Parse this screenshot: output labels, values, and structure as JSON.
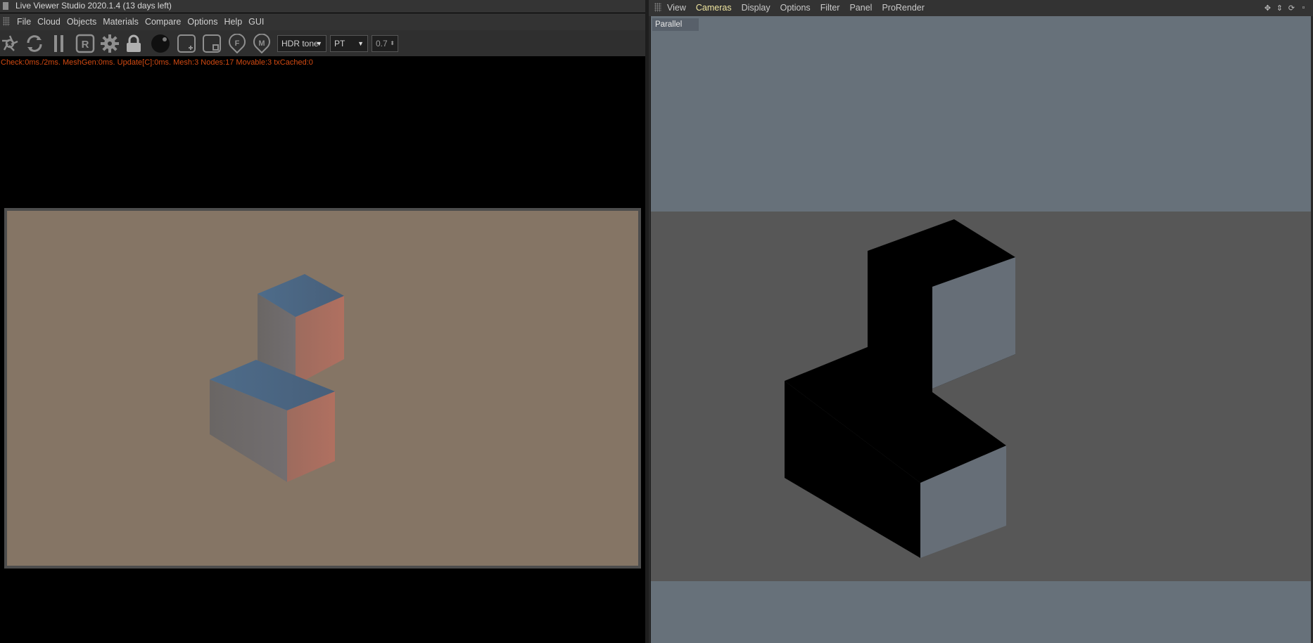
{
  "live_viewer": {
    "title": "Live Viewer Studio 2020.1.4 (13 days left)",
    "menu": [
      "File",
      "Cloud",
      "Objects",
      "Materials",
      "Compare",
      "Options",
      "Help",
      "GUI"
    ],
    "toolbar": {
      "icons": [
        "shutter-icon",
        "refresh-icon",
        "pause-icon",
        "region-render-icon",
        "settings-gear-icon",
        "lock-icon",
        "material-sphere-icon",
        "add-frame-icon",
        "crop-frame-icon",
        "focus-pin-icon",
        "material-pin-icon"
      ],
      "tone_mode": "HDR tone",
      "kernel": "PT",
      "exposure": "0.7"
    },
    "stats": "Check:0ms./2ms. MeshGen:0ms. Update[C]:0ms. Mesh:3 Nodes:17 Movable:3 txCached:0"
  },
  "viewport": {
    "menu": [
      "View",
      "Cameras",
      "Display",
      "Options",
      "Filter",
      "Panel",
      "ProRender"
    ],
    "active_menu": "Cameras",
    "camera_label": "Parallel",
    "nav_icons": [
      "move-icon",
      "dolly-icon",
      "rotate-icon",
      "maximize-icon"
    ]
  },
  "colors": {
    "render_background": "#857565",
    "cube_top": "#4b6a88",
    "cube_left": "#6a6868",
    "cube_right": "#a66d5e",
    "viewport_sky": "#67717a",
    "viewport_floor": "#575757",
    "stats_text": "#d24a12",
    "active_menu": "#f0e6a0"
  }
}
